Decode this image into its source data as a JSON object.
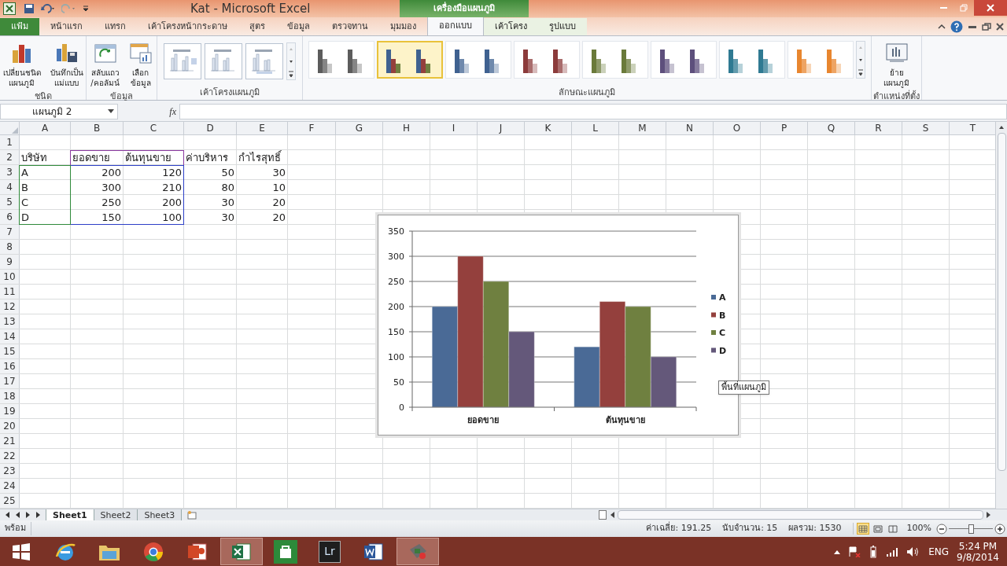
{
  "window": {
    "title": "Kat - Microsoft Excel",
    "context_group": "เครื่องมือแผนภูมิ"
  },
  "tabs": [
    {
      "label": "แฟ้ม",
      "kind": "file",
      "selected": false
    },
    {
      "label": "หน้าแรก",
      "kind": "tab",
      "selected": false
    },
    {
      "label": "แทรก",
      "kind": "tab",
      "selected": false
    },
    {
      "label": "เค้าโครงหน้ากระดาษ",
      "kind": "tab",
      "selected": false
    },
    {
      "label": "สูตร",
      "kind": "tab",
      "selected": false
    },
    {
      "label": "ข้อมูล",
      "kind": "tab",
      "selected": false
    },
    {
      "label": "ตรวจทาน",
      "kind": "tab",
      "selected": false
    },
    {
      "label": "มุมมอง",
      "kind": "tab",
      "selected": false
    },
    {
      "label": "ออกแบบ",
      "kind": "context",
      "selected": true
    },
    {
      "label": "เค้าโครง",
      "kind": "context",
      "selected": false
    },
    {
      "label": "รูปแบบ",
      "kind": "context",
      "selected": false
    }
  ],
  "ribbon": {
    "groups": [
      {
        "title": "ชนิด",
        "buttons": [
          {
            "label": "เปลี่ยนชนิด\nแผนภูมิ",
            "kind": "chart-type"
          },
          {
            "label": "บันทึกเป็น\nแม่แบบ",
            "kind": "save-template"
          }
        ]
      },
      {
        "title": "ข้อมูล",
        "buttons": [
          {
            "label": "สลับแถว\n/คอลัมน์",
            "kind": "switch"
          },
          {
            "label": "เลือก\nข้อมูล",
            "kind": "select-data"
          }
        ]
      },
      {
        "title": "เค้าโครงแผนภูมิ",
        "kind": "layouts"
      },
      {
        "title": "ลักษณะแผนภูมิ",
        "kind": "styles"
      },
      {
        "title": "ตำแหน่งที่ตั้ง",
        "buttons": [
          {
            "label": "ย้าย\nแผนภูมิ",
            "kind": "move"
          }
        ]
      }
    ],
    "chart_styles": [
      {
        "kind": "mono",
        "color": "#5c5c5c",
        "selected": false
      },
      {
        "kind": "multi",
        "selected": true
      },
      {
        "kind": "mono",
        "color": "#3f6190",
        "selected": false
      },
      {
        "kind": "mono",
        "color": "#8c3b3b",
        "selected": false
      },
      {
        "kind": "mono",
        "color": "#6a7a3a",
        "selected": false
      },
      {
        "kind": "mono",
        "color": "#5d4f7c",
        "selected": false
      },
      {
        "kind": "mono",
        "color": "#2f7a92",
        "selected": false
      },
      {
        "kind": "mono",
        "color": "#e8862f",
        "selected": false
      }
    ]
  },
  "formula_bar": {
    "name_box": "แผนภูมิ 2",
    "function_label": "fx"
  },
  "columns": [
    "A",
    "B",
    "C",
    "D",
    "E",
    "F",
    "G",
    "H",
    "I",
    "J",
    "K",
    "L",
    "M",
    "N",
    "O",
    "P",
    "Q",
    "R",
    "S",
    "T"
  ],
  "rows": [
    {
      "number": "1"
    },
    {
      "number": "2",
      "kind": "header",
      "cells": [
        "บริษัท",
        "ยอดขาย",
        "ต้นทุนขาย",
        "ค่าบริหาร",
        "กำไรสุทธิ์"
      ]
    },
    {
      "number": "3",
      "kind": "data",
      "cells": [
        "A",
        "200",
        "120",
        "50",
        "30"
      ]
    },
    {
      "number": "4",
      "kind": "data",
      "cells": [
        "B",
        "300",
        "210",
        "80",
        "10"
      ]
    },
    {
      "number": "5",
      "kind": "data",
      "cells": [
        "C",
        "250",
        "200",
        "30",
        "20"
      ]
    },
    {
      "number": "6",
      "kind": "data",
      "cells": [
        "D",
        "150",
        "100",
        "30",
        "20"
      ]
    },
    {
      "number": "7"
    },
    {
      "number": "8"
    },
    {
      "number": "9"
    },
    {
      "number": "10"
    },
    {
      "number": "11"
    },
    {
      "number": "12"
    },
    {
      "number": "13"
    },
    {
      "number": "14"
    },
    {
      "number": "15"
    },
    {
      "number": "16"
    },
    {
      "number": "17"
    },
    {
      "number": "18"
    },
    {
      "number": "19"
    },
    {
      "number": "20"
    },
    {
      "number": "21"
    },
    {
      "number": "22"
    },
    {
      "number": "23"
    },
    {
      "number": "24"
    },
    {
      "number": "25"
    }
  ],
  "chart": {
    "tooltip": "พื้นที่แผนภูมิ",
    "chart_data": {
      "type": "bar",
      "categories": [
        "ยอดขาย",
        "ต้นทุนขาย"
      ],
      "series": [
        {
          "name": "A",
          "color": "#4a6a96",
          "values": [
            200,
            120
          ]
        },
        {
          "name": "B",
          "color": "#94403d",
          "values": [
            300,
            210
          ]
        },
        {
          "name": "C",
          "color": "#6f8040",
          "values": [
            250,
            200
          ]
        },
        {
          "name": "D",
          "color": "#64587a",
          "values": [
            150,
            100
          ]
        }
      ],
      "grid": true,
      "legend": true,
      "ylim": [
        0,
        350
      ],
      "yticks": [
        0,
        50,
        100,
        150,
        200,
        250,
        300,
        350
      ]
    }
  },
  "sheet_tabs": [
    {
      "label": "Sheet1",
      "selected": true
    },
    {
      "label": "Sheet2",
      "selected": false
    },
    {
      "label": "Sheet3",
      "selected": false
    }
  ],
  "status_bar": {
    "mode": "พร้อม",
    "stats": [
      "ค่าเฉลี่ย: 191.25",
      "นับจำนวน: 15",
      "ผลรวม: 1530"
    ],
    "views": [
      {
        "kind": "normal",
        "selected": true
      },
      {
        "kind": "page-layout",
        "selected": false
      },
      {
        "kind": "page-break",
        "selected": false
      }
    ],
    "zoom": "100%",
    "zoom_slider": {
      "level": 0.5
    }
  },
  "taskbar": {
    "apps": [
      {
        "kind": "start",
        "active": false
      },
      {
        "kind": "browser",
        "active": false
      },
      {
        "kind": "folder",
        "active": false
      },
      {
        "kind": "chrome",
        "active": false
      },
      {
        "kind": "slides",
        "active": false
      },
      {
        "kind": "sheet",
        "active": true
      },
      {
        "kind": "store",
        "active": false
      },
      {
        "kind": "lr",
        "label": "Lr",
        "active": false
      },
      {
        "kind": "doc",
        "active": false
      },
      {
        "kind": "tool",
        "active": true
      }
    ],
    "language": "ENG",
    "time": "5:24 PM",
    "date": "9/8/2014"
  }
}
